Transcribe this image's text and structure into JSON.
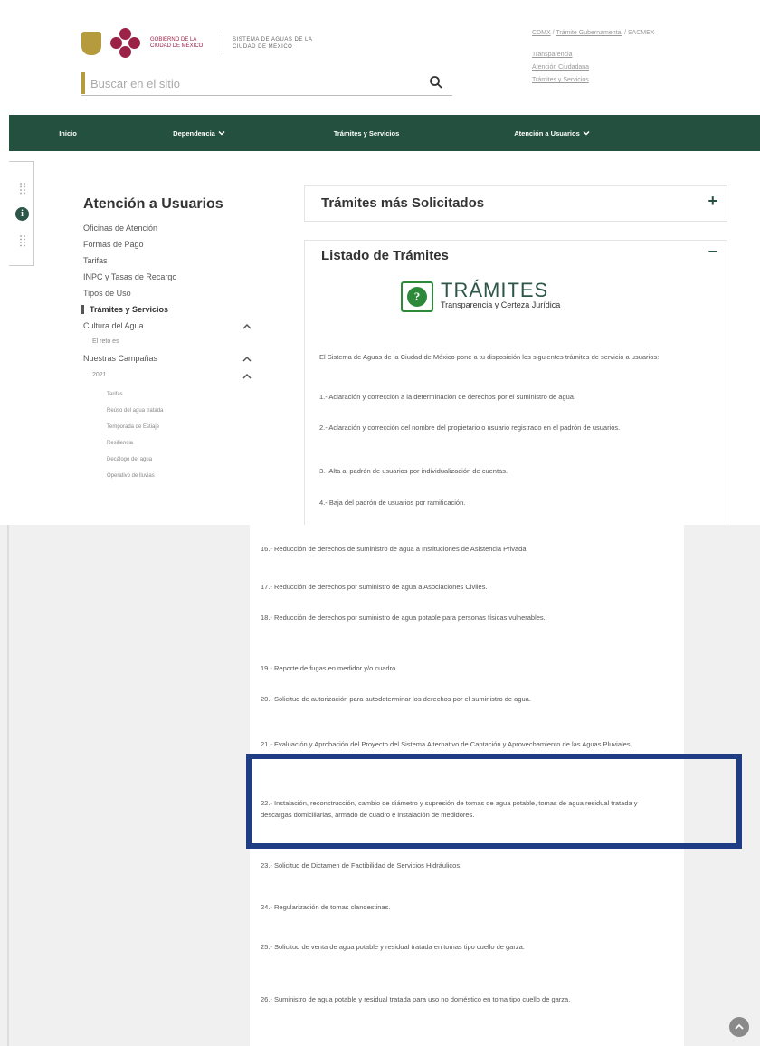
{
  "header": {
    "logo_gov_text": "Gobierno de la Ciudad de México",
    "logo_system_text": "Sistema de Aguas de la Ciudad de México",
    "search_placeholder": "Buscar en el sitio",
    "util_cdmx": "CDMX",
    "util_sep1": " / ",
    "util_tramite": "Trámite Gubernamental",
    "util_sep2": " / ",
    "util_sacmex": "SACMEX",
    "util_links": [
      "Transparencia",
      "Atención Ciudadana",
      "Trámites y Servicios"
    ]
  },
  "nav": {
    "items": [
      "Inicio",
      "Dependencia",
      "Trámites y Servicios",
      "Atención a Usuarios"
    ]
  },
  "sidebar": {
    "title": "Atención a Usuarios",
    "items": [
      "Oficinas de Atención",
      "Formas de Pago",
      "Tarifas",
      "INPC y Tasas de Recargo",
      "Tipos de Uso",
      "Trámites y Servicios",
      "Cultura del Agua",
      "El reto es",
      "Nuestras Campañas",
      "2021",
      "Tarifas",
      "Reúso del agua tratada",
      "Temporada de Estiaje",
      "Resiliencia",
      "Decálogo del agua",
      "Operativo de lluvias"
    ]
  },
  "cards": {
    "mas_solicitados": "Trámites más Solicitados",
    "mas_solicitados_toggle": "+",
    "listado": "Listado de Trámites",
    "listado_toggle": "−"
  },
  "tramites_logo": {
    "word": "TRÁMITES",
    "subtitle": "Transparencia y Certeza Jurídica"
  },
  "tramites_list_top": [
    "El Sistema de Aguas de la Ciudad de México pone a tu disposición los siguientes trámites de servicio a usuarios:",
    "1.- Aclaración y corrección a la determinación de derechos por el suministro de agua.",
    "2.- Aclaración y corrección del nombre del propietario o usuario registrado en el padrón de usuarios.",
    "3.- Alta al padrón de usuarios por individualización de cuentas.",
    "4.- Baja del padrón de usuarios por ramificación."
  ],
  "tramites_list_bottom": [
    "16.- Reducción de derechos de suministro de agua a Instituciones de Asistencia Privada.",
    "17.- Reducción de derechos por suministro de agua a Asociaciones Civiles.",
    "18.- Reducción de derechos por suministro de agua potable para personas físicas vulnerables.",
    "19.- Reporte de fugas en medidor y/o cuadro.",
    "20.- Solicitud de autorización para autodeterminar los derechos por el suministro de agua.",
    "21.- Evaluación y Aprobación del Proyecto del Sistema Alternativo de Captación y Aprovechamiento de las Aguas Pluviales.",
    "22.- Instalación, reconstrucción, cambio de diámetro y supresión de tomas de agua potable, tomas de agua residual tratada y descargas domiciliarias, armado de cuadro e instalación de medidores.",
    "23.- Solicitud de Dictamen de Factibilidad de Servicios Hidráulicos.",
    "24.- Regularización de tomas clandestinas.",
    "25.- Solicitud de venta de agua potable y residual tratada en tomas tipo cuello de garza.",
    "26.- Suministro de agua potable y residual tratada para uso no doméstico en toma tipo cuello de garza."
  ],
  "colors": {
    "nav_green": "#24503f",
    "highlight_blue": "#1f3d85",
    "gold": "#b59a3e",
    "brand_maroon": "#9c2147"
  },
  "icons": {
    "search": "search-icon",
    "chevron": "chevron-down-icon",
    "caret_up": "caret-up-icon",
    "info": "info-icon",
    "grid": "grid-icon",
    "scroll_top": "arrow-up-icon"
  }
}
